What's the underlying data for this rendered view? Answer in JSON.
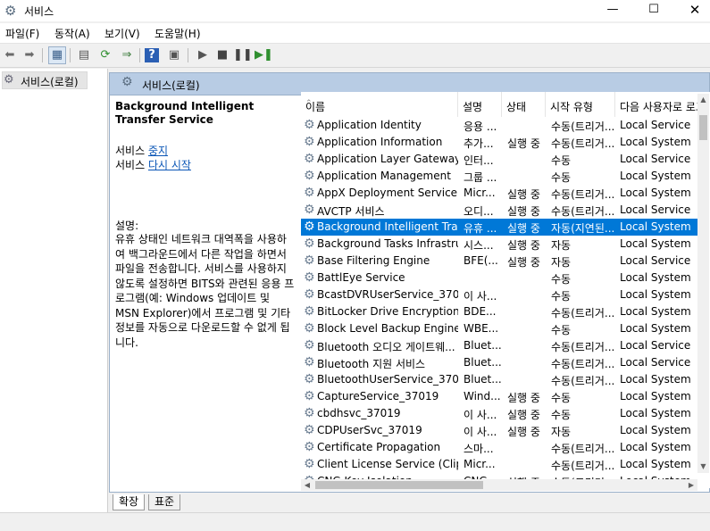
{
  "window": {
    "title": "서비스",
    "minimize": "—",
    "maximize": "☐",
    "close": "✕"
  },
  "menu": [
    "파일(F)",
    "동작(A)",
    "보기(V)",
    "도움말(H)"
  ],
  "tree": {
    "root_label": "서비스(로컬)"
  },
  "pane": {
    "header": "서비스(로컬)",
    "service_title": "Background Intelligent Transfer Service",
    "stop_prefix": "서비스 ",
    "stop_link": "중지",
    "restart_prefix": "서비스 ",
    "restart_link": "다시 시작",
    "desc_label": "설명:",
    "desc_text": "유휴 상태인 네트워크 대역폭을 사용하여 백그라운드에서 다른 작업을 하면서 파일을 전송합니다. 서비스를 사용하지 않도록 설정하면 BITS와 관련된 응용 프로그램(예: Windows 업데이트 및 MSN Explorer)에서 프로그램 및 기타 정보를 자동으로 다운로드할 수 없게 됩니다."
  },
  "columns": {
    "name": "이름",
    "desc": "설명",
    "status": "상태",
    "start": "시작 유형",
    "logon": "다음 사용자로 로그온"
  },
  "services": [
    {
      "name": "Application Identity",
      "desc": "응용 ...",
      "status": "",
      "start": "수동(트리거...",
      "logon": "Local Service"
    },
    {
      "name": "Application Information",
      "desc": "추가...",
      "status": "실행 중",
      "start": "수동(트리거...",
      "logon": "Local System"
    },
    {
      "name": "Application Layer Gateway ...",
      "desc": "인터...",
      "status": "",
      "start": "수동",
      "logon": "Local Service"
    },
    {
      "name": "Application Management",
      "desc": "그룹 ...",
      "status": "",
      "start": "수동",
      "logon": "Local System"
    },
    {
      "name": "AppX Deployment Service ...",
      "desc": "Micr...",
      "status": "실행 중",
      "start": "수동(트리거...",
      "logon": "Local System"
    },
    {
      "name": "AVCTP 서비스",
      "desc": "오디...",
      "status": "실행 중",
      "start": "수동(트리거...",
      "logon": "Local Service"
    },
    {
      "name": "Background Intelligent Tra...",
      "desc": "유휴 ...",
      "status": "실행 중",
      "start": "자동(지연된...",
      "logon": "Local System",
      "selected": true
    },
    {
      "name": "Background Tasks Infrastru...",
      "desc": "시스...",
      "status": "실행 중",
      "start": "자동",
      "logon": "Local System"
    },
    {
      "name": "Base Filtering Engine",
      "desc": "BFE(...",
      "status": "실행 중",
      "start": "자동",
      "logon": "Local Service"
    },
    {
      "name": "BattlEye Service",
      "desc": "",
      "status": "",
      "start": "수동",
      "logon": "Local System"
    },
    {
      "name": "BcastDVRUserService_37019",
      "desc": "이 사...",
      "status": "",
      "start": "수동",
      "logon": "Local System"
    },
    {
      "name": "BitLocker Drive Encryption ...",
      "desc": "BDE...",
      "status": "",
      "start": "수동(트리거...",
      "logon": "Local System"
    },
    {
      "name": "Block Level Backup Engine ...",
      "desc": "WBE...",
      "status": "",
      "start": "수동",
      "logon": "Local System"
    },
    {
      "name": "Bluetooth 오디오 게이트웨...",
      "desc": "Bluet...",
      "status": "",
      "start": "수동(트리거...",
      "logon": "Local Service"
    },
    {
      "name": "Bluetooth 지원 서비스",
      "desc": "Bluet...",
      "status": "",
      "start": "수동(트리거...",
      "logon": "Local Service"
    },
    {
      "name": "BluetoothUserService_37019",
      "desc": "Bluet...",
      "status": "",
      "start": "수동(트리거...",
      "logon": "Local System"
    },
    {
      "name": "CaptureService_37019",
      "desc": "Wind...",
      "status": "실행 중",
      "start": "수동",
      "logon": "Local System"
    },
    {
      "name": "cbdhsvc_37019",
      "desc": "이 사...",
      "status": "실행 중",
      "start": "수동",
      "logon": "Local System"
    },
    {
      "name": "CDPUserSvc_37019",
      "desc": "이 사...",
      "status": "실행 중",
      "start": "자동",
      "logon": "Local System"
    },
    {
      "name": "Certificate Propagation",
      "desc": "스마...",
      "status": "",
      "start": "수동(트리거...",
      "logon": "Local System"
    },
    {
      "name": "Client License Service (Clip...",
      "desc": "Micr...",
      "status": "",
      "start": "수동(트리거...",
      "logon": "Local System"
    },
    {
      "name": "CNG Key Isolation",
      "desc": "CNG...",
      "status": "실행 중",
      "start": "수동(트리거...",
      "logon": "Local System"
    }
  ],
  "tabs": [
    "확장",
    "표준"
  ]
}
